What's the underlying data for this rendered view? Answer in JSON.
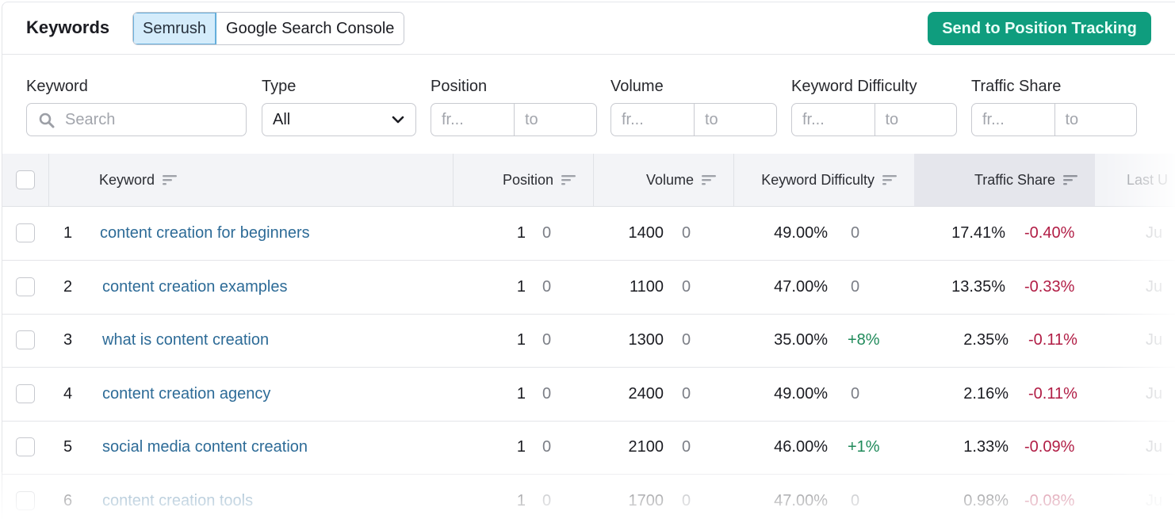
{
  "header": {
    "title": "Keywords",
    "sources": [
      {
        "label": "Semrush",
        "active": true
      },
      {
        "label": "Google Search Console",
        "active": false
      }
    ],
    "send_button": "Send to Position Tracking"
  },
  "filters": {
    "keyword": {
      "label": "Keyword",
      "placeholder": "Search"
    },
    "type": {
      "label": "Type",
      "value": "All"
    },
    "position": {
      "label": "Position",
      "from_placeholder": "fr...",
      "to_placeholder": "to"
    },
    "volume": {
      "label": "Volume",
      "from_placeholder": "fr...",
      "to_placeholder": "to"
    },
    "keyword_difficulty": {
      "label": "Keyword Difficulty",
      "from_placeholder": "fr...",
      "to_placeholder": "to"
    },
    "traffic_share": {
      "label": "Traffic Share",
      "from_placeholder": "fr...",
      "to_placeholder": "to"
    }
  },
  "table": {
    "columns": {
      "keyword": "Keyword",
      "position": "Position",
      "volume": "Volume",
      "keyword_difficulty": "Keyword Difficulty",
      "traffic_share": "Traffic Share",
      "last_updated": "Last U"
    },
    "sorted_column": "traffic_share",
    "rows": [
      {
        "index": "1",
        "keyword": "content creation for beginners",
        "position": "1",
        "position_change": "0",
        "volume": "1400",
        "volume_change": "0",
        "kd": "49.00%",
        "kd_change": "0",
        "kd_change_type": "neutral",
        "traffic_share": "17.41%",
        "traffic_change": "-0.40%",
        "last_updated": "Ju"
      },
      {
        "index": "2",
        "keyword": "content creation examples",
        "position": "1",
        "position_change": "0",
        "volume": "1100",
        "volume_change": "0",
        "kd": "47.00%",
        "kd_change": "0",
        "kd_change_type": "neutral",
        "traffic_share": "13.35%",
        "traffic_change": "-0.33%",
        "last_updated": "Ju"
      },
      {
        "index": "3",
        "keyword": "what is content creation",
        "position": "1",
        "position_change": "0",
        "volume": "1300",
        "volume_change": "0",
        "kd": "35.00%",
        "kd_change": "+8%",
        "kd_change_type": "positive",
        "traffic_share": "2.35%",
        "traffic_change": "-0.11%",
        "last_updated": "Ju"
      },
      {
        "index": "4",
        "keyword": "content creation agency",
        "position": "1",
        "position_change": "0",
        "volume": "2400",
        "volume_change": "0",
        "kd": "49.00%",
        "kd_change": "0",
        "kd_change_type": "neutral",
        "traffic_share": "2.16%",
        "traffic_change": "-0.11%",
        "last_updated": "Ju"
      },
      {
        "index": "5",
        "keyword": "social media content creation",
        "position": "1",
        "position_change": "0",
        "volume": "2100",
        "volume_change": "0",
        "kd": "46.00%",
        "kd_change": "+1%",
        "kd_change_type": "positive",
        "traffic_share": "1.33%",
        "traffic_change": "-0.09%",
        "last_updated": "Ju"
      },
      {
        "index": "6",
        "keyword": "content creation tools",
        "position": "1",
        "position_change": "0",
        "volume": "1700",
        "volume_change": "0",
        "kd": "47.00%",
        "kd_change": "0",
        "kd_change_type": "neutral",
        "traffic_share": "0.98%",
        "traffic_change": "-0.08%",
        "last_updated": "Ju"
      }
    ]
  },
  "colors": {
    "brand_green": "#0f9d7e",
    "link_blue": "#2d6b97",
    "negative": "#b11d45",
    "positive": "#1f8a5a",
    "active_tab_bg": "#d4ecfb"
  }
}
